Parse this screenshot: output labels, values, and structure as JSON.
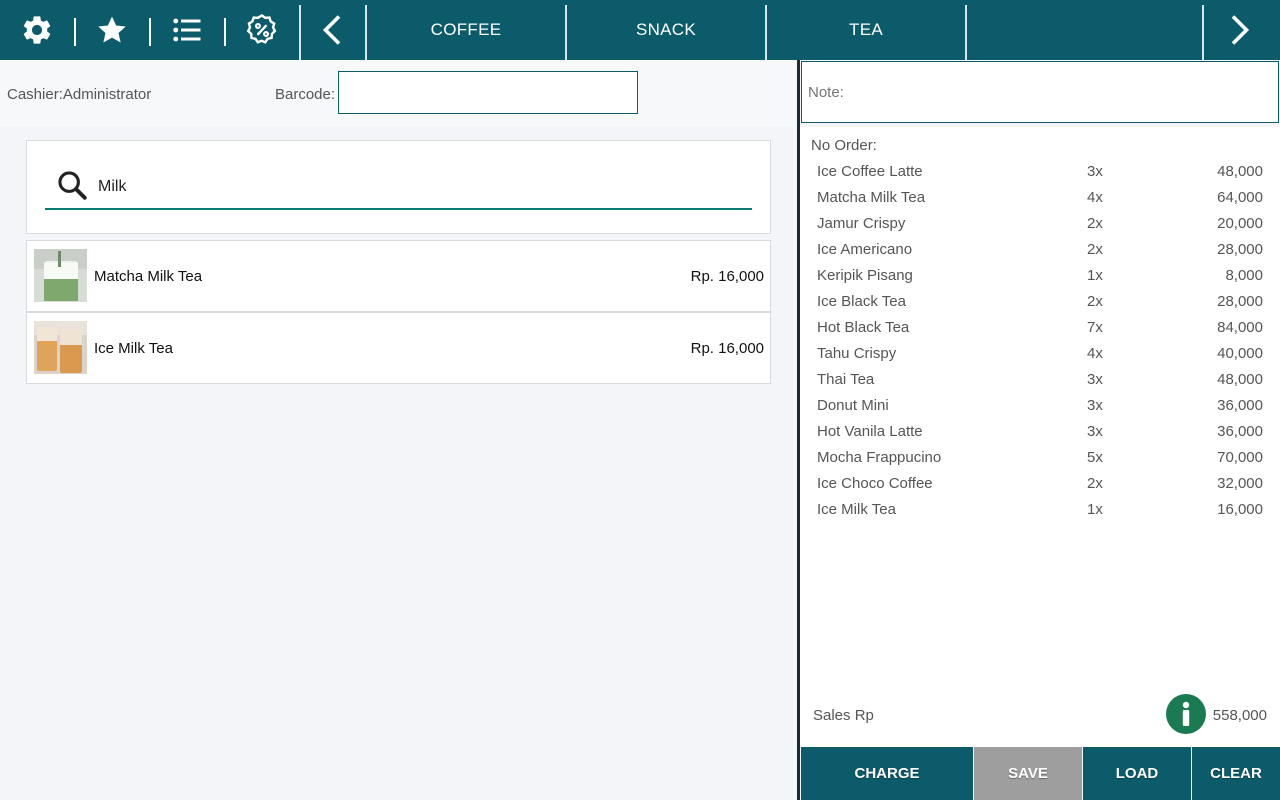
{
  "colors": {
    "accent": "#0b5b6b",
    "save_button": "#9e9e9e",
    "info": "#1a7a52"
  },
  "toolbar": {
    "icons": [
      "gear-icon",
      "star-icon",
      "list-icon",
      "discount-badge-icon",
      "chevron-left-icon",
      "chevron-right-icon"
    ]
  },
  "tabs": [
    "COFFEE",
    "SNACK",
    "TEA"
  ],
  "header": {
    "cashier": "Cashier:Administrator",
    "barcode_label": "Barcode:",
    "barcode_value": ""
  },
  "search": {
    "value": "Milk"
  },
  "results": [
    {
      "name": "Matcha Milk Tea",
      "price": "Rp. 16,000"
    },
    {
      "name": "Ice Milk Tea",
      "price": "Rp. 16,000"
    }
  ],
  "note": {
    "placeholder": "Note:"
  },
  "order": {
    "title": "No Order:",
    "items": [
      {
        "name": "Ice Coffee Latte",
        "qty": "3x",
        "price": "48,000"
      },
      {
        "name": "Matcha Milk Tea",
        "qty": "4x",
        "price": "64,000"
      },
      {
        "name": "Jamur Crispy",
        "qty": "2x",
        "price": "20,000"
      },
      {
        "name": "Ice Americano",
        "qty": "2x",
        "price": "28,000"
      },
      {
        "name": "Keripik Pisang",
        "qty": "1x",
        "price": "8,000"
      },
      {
        "name": "Ice Black Tea",
        "qty": "2x",
        "price": "28,000"
      },
      {
        "name": "Hot Black Tea",
        "qty": "7x",
        "price": "84,000"
      },
      {
        "name": "Tahu Crispy",
        "qty": "4x",
        "price": "40,000"
      },
      {
        "name": "Thai Tea",
        "qty": "3x",
        "price": "48,000"
      },
      {
        "name": "Donut Mini",
        "qty": "3x",
        "price": "36,000"
      },
      {
        "name": "Hot Vanila Latte",
        "qty": "3x",
        "price": "36,000"
      },
      {
        "name": "Mocha Frappucino",
        "qty": "5x",
        "price": "70,000"
      },
      {
        "name": "Ice Choco Coffee",
        "qty": "2x",
        "price": "32,000"
      },
      {
        "name": "Ice Milk Tea",
        "qty": "1x",
        "price": "16,000"
      }
    ],
    "sales_label": "Sales Rp",
    "sales_total": "558,000"
  },
  "buttons": {
    "charge": "CHARGE",
    "save": "SAVE",
    "load": "LOAD",
    "clear": "CLEAR"
  }
}
